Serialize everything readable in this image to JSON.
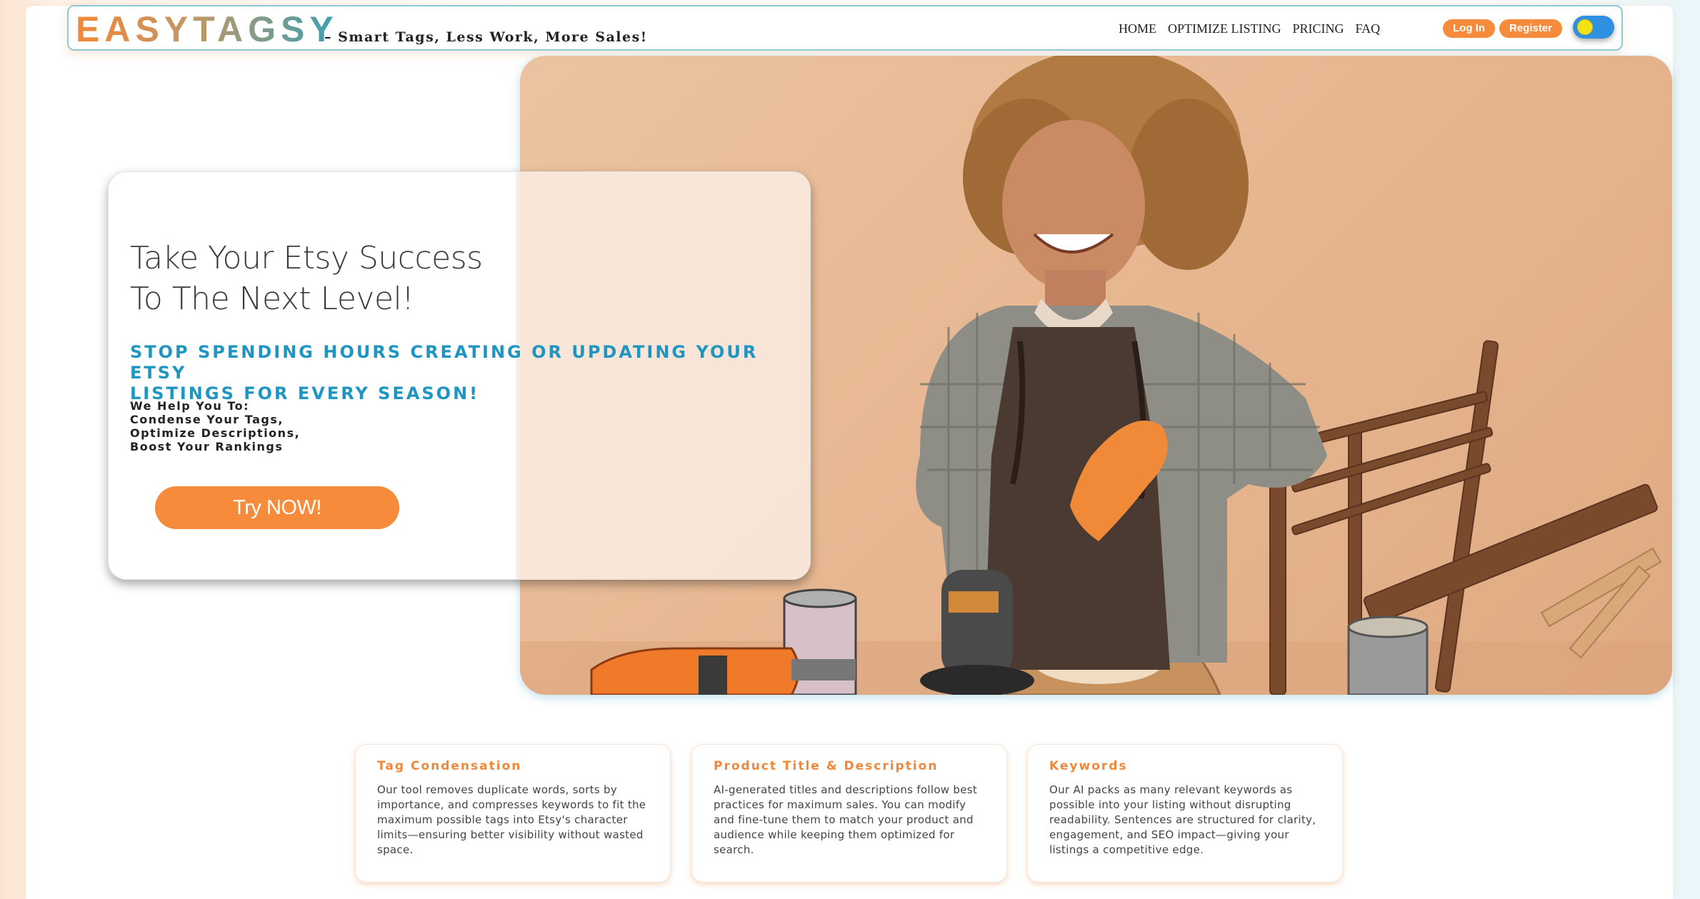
{
  "header": {
    "logo": "EASYTAGSY",
    "tagline": "– Smart Tags, Less Work, More Sales!",
    "nav": [
      "HOME",
      "OPTIMIZE LISTING",
      "PRICING",
      "FAQ"
    ],
    "login_label": "Log In",
    "register_label": "Register"
  },
  "hero": {
    "heading_line1": "Take Your Etsy Success",
    "heading_line2": "To The Next Level!",
    "subheading_line1": "STOP SPENDING HOURS CREATING OR UPDATING YOUR ETSY",
    "subheading_line2": "LISTINGS FOR EVERY SEASON!",
    "help_lines": [
      "We Help You To:",
      "Condense Your Tags,",
      "Optimize Descriptions,",
      "Boost Your Rankings"
    ],
    "cta_label": "Try NOW!"
  },
  "features": [
    {
      "title": "Tag Condensation",
      "text": "Our tool removes duplicate words, sorts by importance, and compresses keywords to fit the maximum possible tags into Etsy's character limits—ensuring better visibility without wasted space."
    },
    {
      "title": "Product Title & Description",
      "text": "AI-generated titles and descriptions follow best practices for maximum sales. You can modify and fine-tune them to match your product and audience while keeping them optimized for search."
    },
    {
      "title": "Keywords",
      "text": "Our AI packs as many relevant keywords as possible into your listing without disrupting readability. Sentences are structured for clarity, engagement, and SEO impact—giving your listings a competitive edge."
    }
  ],
  "colors": {
    "accent": "#f58b3b",
    "brand_blue": "#1f95c2",
    "border": "#8ec9d6"
  }
}
